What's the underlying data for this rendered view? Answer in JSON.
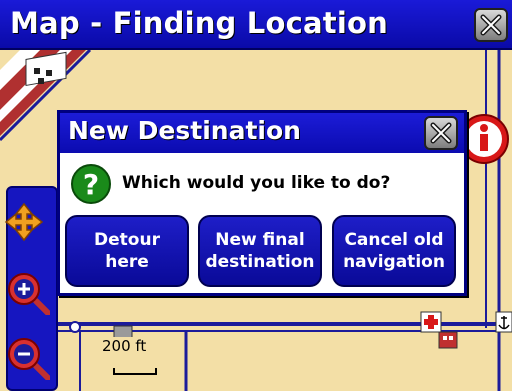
{
  "window": {
    "title": "Map - Finding Location",
    "close_icon": "close-x-icon"
  },
  "map": {
    "scale_label": "200 ft",
    "info_icon": "info-icon",
    "toolbar": {
      "pan_icon": "pan-arrows-icon",
      "zoom_in_icon": "zoom-in-icon",
      "zoom_out_icon": "zoom-out-icon"
    },
    "poi_icons": [
      "hospital-icon",
      "anchor-icon"
    ]
  },
  "dialog": {
    "title": "New Destination",
    "question": "Which would you like to do?",
    "question_icon": "question-icon",
    "options": [
      {
        "label": "Detour\nhere"
      },
      {
        "label": "New final\ndestination"
      },
      {
        "label": "Cancel old\nnavigation"
      }
    ]
  },
  "colors": {
    "titlebar": "#0a0aa8",
    "map_background": "#f3dfa6",
    "road": "#1b1b9a",
    "button": "#1414b8",
    "info_red": "#d81818",
    "question_green": "#1a8a1a"
  }
}
